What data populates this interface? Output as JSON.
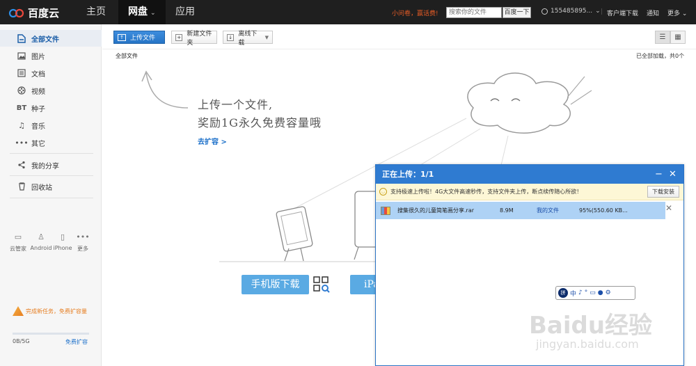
{
  "topbar": {
    "logo_text": "百度云",
    "nav": [
      {
        "label": "主页",
        "active": false
      },
      {
        "label": "网盘",
        "active": true,
        "caret": "⌄"
      },
      {
        "label": "应用",
        "active": false
      }
    ],
    "promo": "小问卷，赢话费!",
    "search_placeholder": "搜索你的文件",
    "search_button": "百度一下",
    "user": "155485895...",
    "user_caret": "⌄",
    "links": {
      "client_download": "客户端下载",
      "notify": "通知",
      "more": "更多",
      "more_caret": "⌄"
    }
  },
  "sidebar": {
    "items": [
      {
        "label": "全部文件",
        "icon": "file-icon",
        "active": true
      },
      {
        "label": "图片",
        "icon": "image-icon"
      },
      {
        "label": "文档",
        "icon": "document-icon"
      },
      {
        "label": "视频",
        "icon": "video-icon"
      },
      {
        "label": "种子",
        "icon": "bt-icon",
        "icon_text": "BT"
      },
      {
        "label": "音乐",
        "icon": "music-icon"
      },
      {
        "label": "其它",
        "icon": "other-icon"
      },
      {
        "label": "我的分享",
        "icon": "share-icon"
      },
      {
        "label": "回收站",
        "icon": "trash-icon"
      }
    ],
    "devices": [
      {
        "label": "云管家",
        "icon": "monitor-icon"
      },
      {
        "label": "Android",
        "icon": "android-icon"
      },
      {
        "label": "iPhone",
        "icon": "iphone-icon"
      },
      {
        "label": "更多",
        "icon": "more-icon"
      }
    ],
    "task_promo": "完成新任务，免费扩容量",
    "quota_text": "0B/5G",
    "quota_link": "免费扩容"
  },
  "toolbar": {
    "upload": "上传文件",
    "new_folder": "新建文件夹",
    "offline": "离线下载"
  },
  "breadcrumb": "全部文件",
  "loaded_status": "已全部加载，共0个",
  "empty": {
    "line1": "上传一个文件,",
    "line2": "奖励1G永久免费容量哦",
    "expand": "去扩容 >",
    "mobile_download": "手机版下载",
    "ipad_download": "iPa"
  },
  "upload_panel": {
    "title": "正在上传：1/1",
    "tip": "支持极速上传啦！4G大文件高速秒传，支持文件夹上传，断点续传随心所欲！",
    "tip_button": "下载安装",
    "file": {
      "name": "搜集很久的儿童简笔画分享.rar",
      "size": "8.9M",
      "dest": "我的文件",
      "progress_text": "95%(550.60 KB..."
    }
  },
  "ime": {
    "badge": "拼",
    "text": "中"
  },
  "watermark": {
    "main": "Baidu经验",
    "sub": "jingyan.baidu.com"
  },
  "colors": {
    "accent": "#2f7bd1",
    "topbar": "#1f1f1f",
    "promo": "#e65c26",
    "link": "#1b6fc9"
  }
}
